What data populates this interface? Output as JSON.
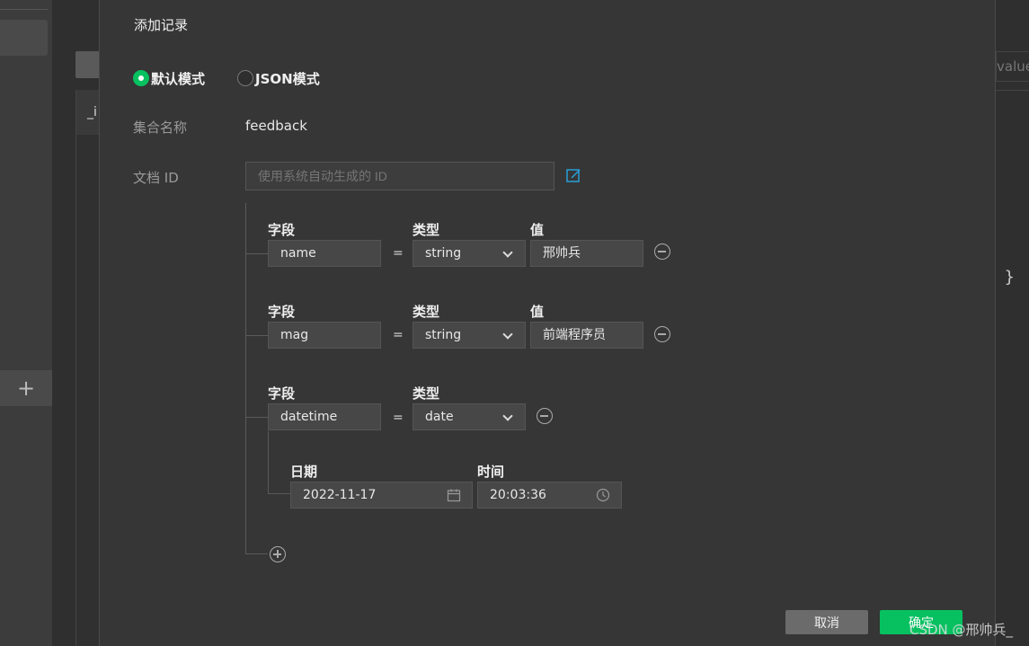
{
  "background": {
    "column_header_partial": "_i",
    "search_partial": "value",
    "brace": "}"
  },
  "dialog": {
    "title": "添加记录",
    "modes": [
      {
        "label": "默认模式",
        "selected": true
      },
      {
        "label": "JSON模式",
        "selected": false
      }
    ],
    "collection_label": "集合名称",
    "collection_value": "feedback",
    "docid_label": "文档 ID",
    "docid_placeholder": "使用系统自动生成的 ID",
    "column_headers": {
      "field": "字段",
      "type": "类型",
      "value": "值"
    },
    "fields": [
      {
        "name": "name",
        "type": "string",
        "value": "邢帅兵"
      },
      {
        "name": "mag",
        "type": "string",
        "value": "前端程序员"
      },
      {
        "name": "datetime",
        "type": "date",
        "date_label": "日期",
        "date_value": "2022-11-17",
        "time_label": "时间",
        "time_value": "20:03:36"
      }
    ],
    "eq_sign": "=",
    "cancel_label": "取消",
    "ok_label": "确定"
  },
  "watermark": "CSDN @邢帅兵_",
  "colors": {
    "accent": "#07c160",
    "dialog_bg": "#363636",
    "link_icon": "#2a9fd8"
  }
}
